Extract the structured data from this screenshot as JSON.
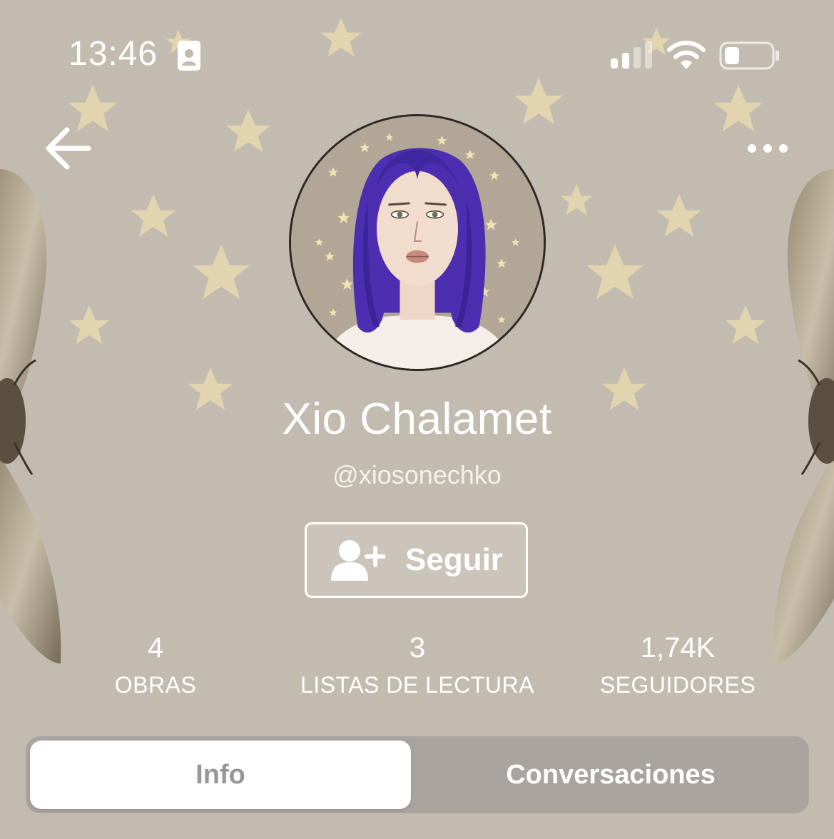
{
  "status_bar": {
    "time": "13:46"
  },
  "profile": {
    "name": "Xio Chalamet",
    "handle": "@xiosonechko",
    "follow_label": "Seguir"
  },
  "stats": [
    {
      "value": "4",
      "label": "OBRAS"
    },
    {
      "value": "3",
      "label": "LISTAS DE LECTURA"
    },
    {
      "value": "1,74K",
      "label": "SEGUIDORES"
    }
  ],
  "tabs": [
    {
      "label": "Info",
      "active": true
    },
    {
      "label": "Conversaciones",
      "active": false
    }
  ],
  "colors": {
    "background": "#c2bbb0",
    "star": "#e8d8b0",
    "hair": "#4b2fb0",
    "tab_track": "#a9a4a0"
  },
  "icons": [
    "id-card-icon",
    "signal-icon",
    "wifi-icon",
    "battery-icon",
    "back-arrow-icon",
    "more-icon",
    "add-user-icon"
  ]
}
